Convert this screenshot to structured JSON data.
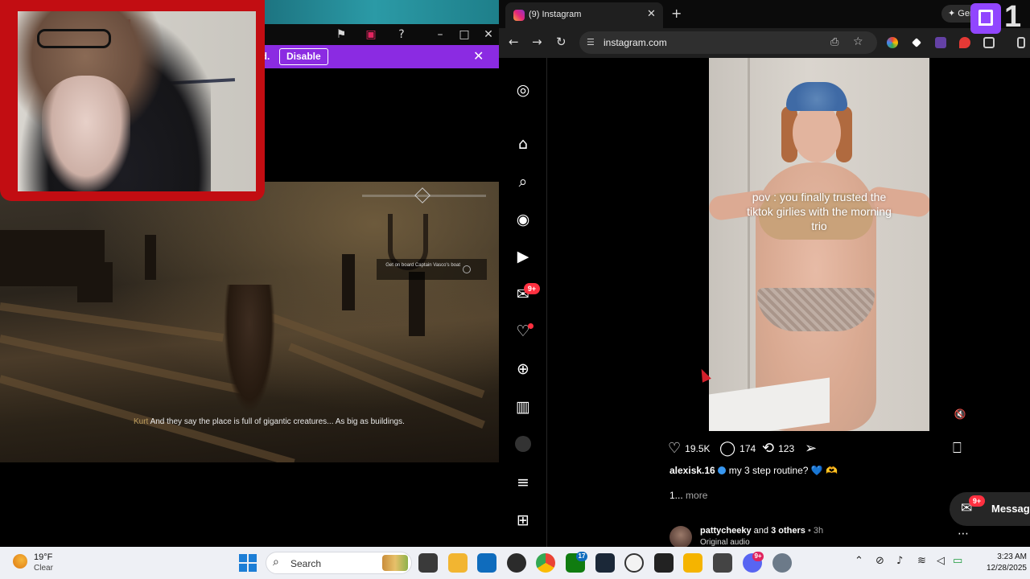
{
  "game": {
    "notify_text": "ed.",
    "disable_label": "Disable",
    "objective": "Get on board Captain Vasco's boat",
    "subtitle_speaker": "Kurt",
    "subtitle_text": "And they say the place is full of gigantic creatures... As big as buildings."
  },
  "browser": {
    "tab_title": "(9) Instagram",
    "gemini_label": "✦ Gem",
    "corner_text": "1",
    "url": "instagram.com"
  },
  "instagram": {
    "rail_badge_messages": "9+",
    "post": {
      "video_caption": "pov : you finally trusted the tiktok girlies with the morning trio",
      "likes": "19.5K",
      "comments": "174",
      "reposts": "123",
      "username": "alexisk.16",
      "caption": "my 3 step routine? 💙 🫶",
      "more_prefix": "1...",
      "more_label": "more"
    },
    "next_post": {
      "author": "pattycheeky",
      "and_others": "and",
      "others_label": "3 others",
      "time": "• 3h",
      "audio": "Original audio"
    },
    "messages": {
      "label": "Messages",
      "badge": "9+"
    }
  },
  "taskbar": {
    "temperature": "19°F",
    "condition": "Clear",
    "search_placeholder": "Search",
    "badge_xbox": "17",
    "badge_discord": "9+",
    "time": "3:23 AM",
    "date": "12/28/2025"
  },
  "colors": {
    "twitch_purple": "#8b2be2",
    "webcam_frame": "#c20d12",
    "ig_badge": "#ff3040"
  }
}
